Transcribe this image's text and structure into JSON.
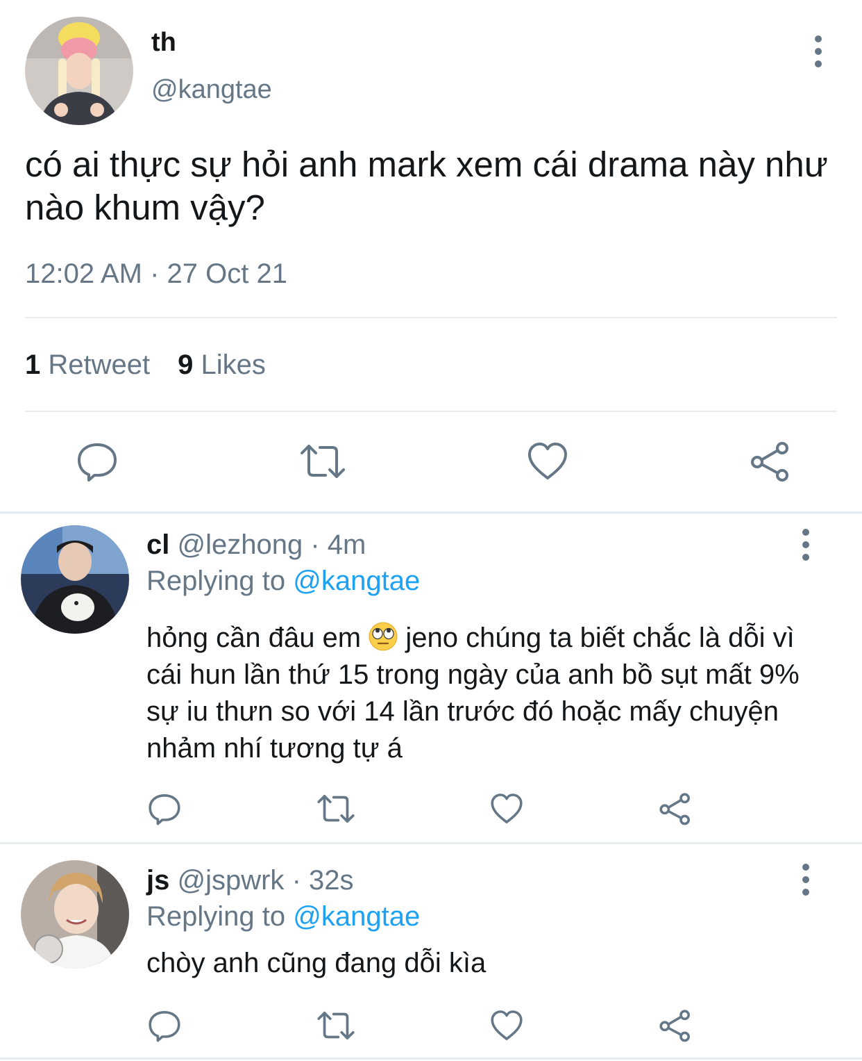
{
  "tweet": {
    "display_name": "th",
    "handle": "@kangtae",
    "text": "có ai thực sự hỏi anh mark xem cái drama này như nào khum vậy?",
    "timestamp": "12:02 AM · 27 Oct 21",
    "retweet_count": "1",
    "retweet_label": "Retweet",
    "like_count": "9",
    "like_label": "Likes"
  },
  "replies": [
    {
      "display_name": "cl",
      "handle": "@lezhong",
      "separator": "·",
      "time": "4m",
      "replying_prefix": "Replying to",
      "replying_to": "@kangtae",
      "text_before_emoji": "hỏng cần đâu em",
      "emoji": "eye-roll-emoji",
      "text_after_emoji": "jeno chúng ta biết chắc là dỗi vì cái hun lần thứ 15 trong ngày của anh bồ sụt mất 9% sự iu thưn so với 14 lần trước đó hoặc mấy chuyện nhảm nhí tương tự á"
    },
    {
      "display_name": "js",
      "handle": "@jspwrk",
      "separator": "·",
      "time": "32s",
      "replying_prefix": "Replying to",
      "replying_to": "@kangtae",
      "text": "chòy anh cũng đang dỗi kìa"
    }
  ],
  "icons": [
    "reply-icon",
    "retweet-icon",
    "like-icon",
    "share-icon",
    "more-options-icon"
  ],
  "colors": {
    "text_primary": "#14171a",
    "text_secondary": "#657786",
    "link": "#1da1f2",
    "divider": "#e6ecf0"
  }
}
